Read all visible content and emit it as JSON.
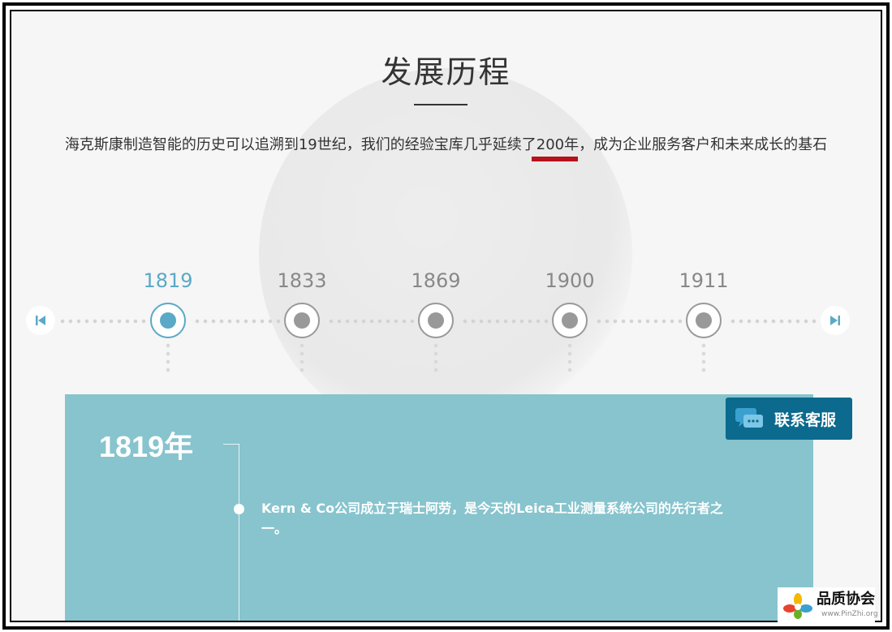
{
  "page": {
    "title": "发展历程",
    "intro_before": "海克斯康制造智能的历史可以追溯到19世纪，我们的经验宝库几乎延续了",
    "intro_highlight": "200年",
    "intro_after": "，成为企业服务客户和未来成长的基石"
  },
  "timeline": {
    "years": [
      "1819",
      "1833",
      "1869",
      "1900",
      "1911"
    ],
    "active_index": 0
  },
  "detail": {
    "year": "1819年",
    "text": "Kern & Co公司成立于瑞士阿劳，是今天的Leica工业测量系统公司的先行者之一。"
  },
  "contact": {
    "label": "联系客服"
  },
  "watermark": {
    "title": "品质协会",
    "url": "www.PinZhi.org"
  },
  "colors": {
    "accent": "#5aa9c6",
    "panel": "#87c4ce",
    "contact": "#0b6a8d",
    "highlight": "#b5121b",
    "inactive": "#999999"
  },
  "icons": {
    "prev": "skip-previous-icon",
    "next": "skip-next-icon",
    "contact": "chat-bubble-icon"
  }
}
